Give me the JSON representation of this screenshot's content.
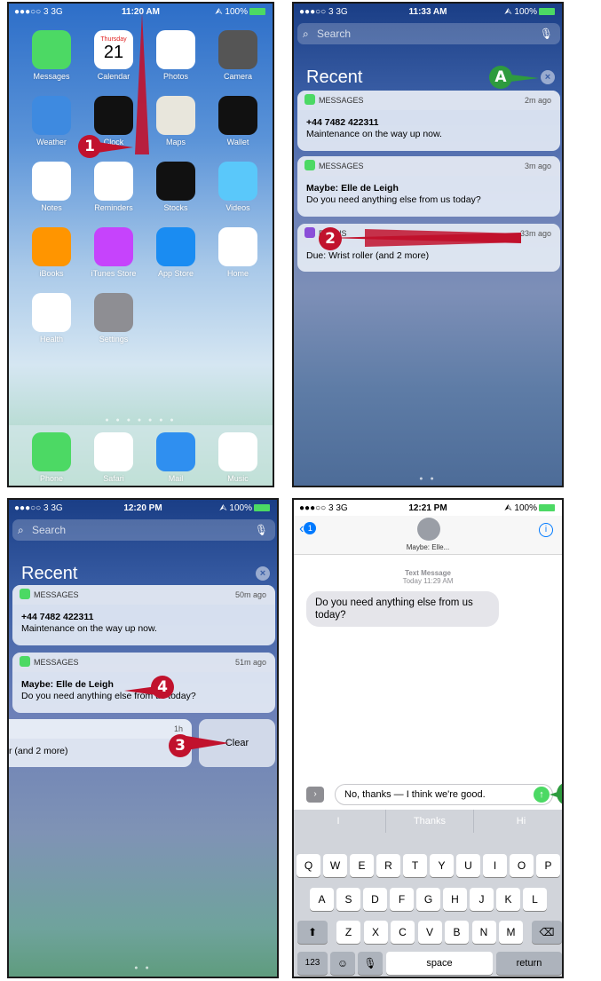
{
  "panel1": {
    "status": {
      "signal": "●●●○○ 3 3G",
      "time": "11:20 AM",
      "right": "⮙ 100%"
    },
    "calendar": {
      "day": "Thursday",
      "date": "21"
    },
    "apps": [
      {
        "label": "Messages",
        "icon": "messages-icon",
        "color": "#4cd964"
      },
      {
        "label": "Calendar",
        "icon": "calendar-icon",
        "color": "#ffffff"
      },
      {
        "label": "Photos",
        "icon": "photos-icon",
        "color": "#ffffff"
      },
      {
        "label": "Camera",
        "icon": "camera-icon",
        "color": "#555555"
      },
      {
        "label": "Weather",
        "icon": "weather-icon",
        "color": "#3e8ae0"
      },
      {
        "label": "Clock",
        "icon": "clock-icon",
        "color": "#111111"
      },
      {
        "label": "Maps",
        "icon": "maps-icon",
        "color": "#e8e6dc"
      },
      {
        "label": "Wallet",
        "icon": "wallet-icon",
        "color": "#111111"
      },
      {
        "label": "Notes",
        "icon": "notes-icon",
        "color": "#ffffff"
      },
      {
        "label": "Reminders",
        "icon": "reminders-icon",
        "color": "#ffffff"
      },
      {
        "label": "Stocks",
        "icon": "stocks-icon",
        "color": "#111111"
      },
      {
        "label": "Videos",
        "icon": "videos-icon",
        "color": "#5ac8fa"
      },
      {
        "label": "iBooks",
        "icon": "ibooks-icon",
        "color": "#ff9500"
      },
      {
        "label": "iTunes Store",
        "icon": "itunes-store-icon",
        "color": "#c643fc"
      },
      {
        "label": "App Store",
        "icon": "app-store-icon",
        "color": "#1a8cf2"
      },
      {
        "label": "Home",
        "icon": "home-icon",
        "color": "#ffffff"
      },
      {
        "label": "Health",
        "icon": "health-icon",
        "color": "#ffffff"
      },
      {
        "label": "Settings",
        "icon": "settings-icon",
        "color": "#8e8e93"
      }
    ],
    "dock": [
      {
        "label": "Phone",
        "icon": "phone-icon",
        "color": "#4cd964"
      },
      {
        "label": "Safari",
        "icon": "safari-icon",
        "color": "#ffffff"
      },
      {
        "label": "Mail",
        "icon": "mail-icon",
        "color": "#2f8ff0"
      },
      {
        "label": "Music",
        "icon": "music-icon",
        "color": "#ffffff"
      }
    ],
    "callout": "1"
  },
  "panel2": {
    "status": {
      "signal": "●●●○○ 3 3G",
      "time": "11:33 AM",
      "right": "⮙ 100%"
    },
    "search_placeholder": "Search",
    "recent": "Recent",
    "callout_a": "A",
    "callout_2": "2",
    "cards": [
      {
        "app": "MESSAGES",
        "ago": "2m ago",
        "title": "+44 7482 422311",
        "text": "Maintenance on the way up now."
      },
      {
        "app": "MESSAGES",
        "ago": "3m ago",
        "title": "Maybe: Elle de Leigh",
        "text": "Do you need anything else from us today?"
      },
      {
        "app": "FOCUS",
        "ago": "33m ago",
        "title": "",
        "text": "Due: Wrist roller (and 2 more)"
      }
    ]
  },
  "panel3": {
    "status": {
      "signal": "●●●○○ 3 3G",
      "time": "12:20 PM",
      "right": "⮙ 100%"
    },
    "search_placeholder": "Search",
    "recent": "Recent",
    "callout_3": "3",
    "callout_4": "4",
    "clear_label": "Clear",
    "cards": [
      {
        "app": "MESSAGES",
        "ago": "50m ago",
        "title": "+44 7482 422311",
        "text": "Maintenance on the way up now."
      },
      {
        "app": "MESSAGES",
        "ago": "51m ago",
        "title": "Maybe: Elle de Leigh",
        "text": "Do you need anything else from us today?"
      },
      {
        "app": "",
        "ago": "1h",
        "title": "",
        "text": "r (and 2 more)"
      }
    ]
  },
  "panel4": {
    "status": {
      "signal": "●●●○○ 3 3G",
      "time": "12:21 PM",
      "right": "⮙ 100%"
    },
    "back_badge": "1",
    "contact": "Maybe: Elle...",
    "timestamp_title": "Text Message",
    "timestamp": "Today 11:29 AM",
    "bubble": "Do you need anything else from us today?",
    "compose_text": "No, thanks — I think we're good.",
    "callout_b": "B",
    "predictions": [
      "I",
      "Thanks",
      "Hi"
    ],
    "row1": [
      "Q",
      "W",
      "E",
      "R",
      "T",
      "Y",
      "U",
      "I",
      "O",
      "P"
    ],
    "row2": [
      "A",
      "S",
      "D",
      "F",
      "G",
      "H",
      "J",
      "K",
      "L"
    ],
    "row3": [
      "Z",
      "X",
      "C",
      "V",
      "B",
      "N",
      "M"
    ],
    "numbers_key": "123",
    "space_key": "space",
    "return_key": "return"
  }
}
